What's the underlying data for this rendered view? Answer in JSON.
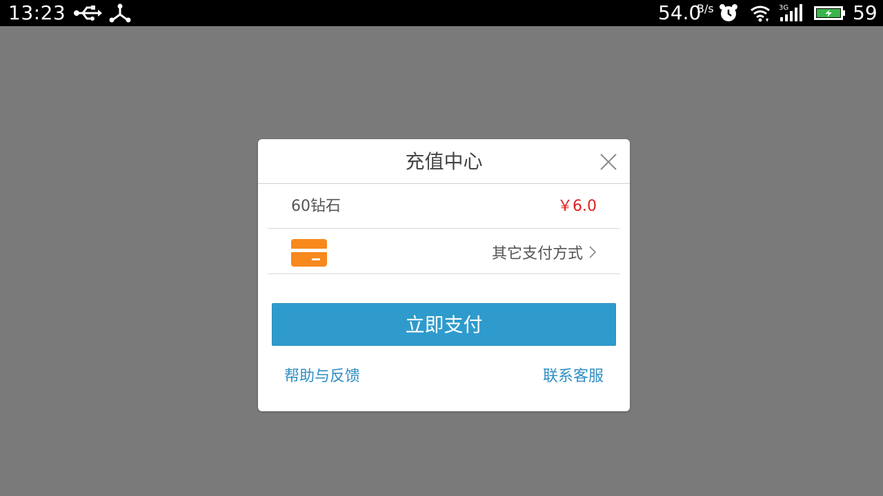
{
  "status_bar": {
    "time": "13:23",
    "net_speed": "54.0",
    "net_speed_unit": "B/s",
    "battery_percent": "59",
    "icons": [
      "usb-icon",
      "debug-icon",
      "alarm-icon",
      "wifi-icon",
      "signal-3g-icon",
      "battery-charging-icon"
    ],
    "network_type": "3G"
  },
  "dialog": {
    "title": "充值中心",
    "item": {
      "name": "60钻石",
      "price": "￥6.0"
    },
    "payment": {
      "icon": "card-icon",
      "other_methods_label": "其它支付方式"
    },
    "pay_button_label": "立即支付",
    "help_link": "帮助与反馈",
    "contact_link": "联系客服"
  },
  "colors": {
    "overlay": "#7a7a7a",
    "accent": "#2f9bcc",
    "price": "#e02020",
    "card_icon": "#f7891d",
    "link": "#2f8fc4"
  }
}
